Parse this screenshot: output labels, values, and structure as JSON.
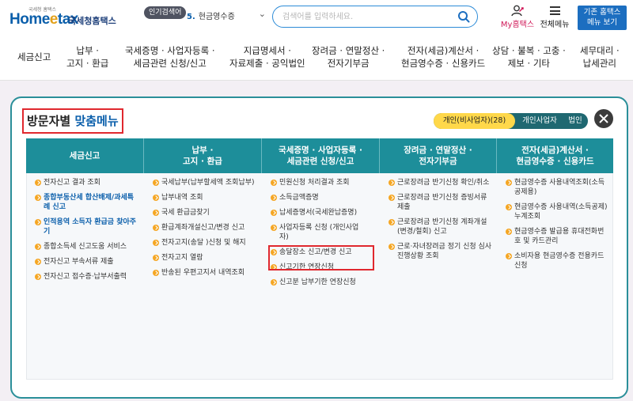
{
  "header": {
    "logo_small": "국세청 홈택스",
    "logo_home": "Home",
    "logo_e": "e",
    "logo_tax": "tax",
    "logo_sub": "국세청홈택스",
    "popular_label": "인기검색어",
    "popular_num": "5.",
    "popular_value": "현금영수증",
    "search_placeholder": "검색어를 입력하세요.",
    "my_hometax": "My홈택스",
    "all_menu": "전체메뉴",
    "old_home_line1": "기존 홈택스",
    "old_home_line2": "메뉴 보기"
  },
  "gnb": [
    {
      "line1": "세금신고",
      "line2": ""
    },
    {
      "line1": "납부 ·",
      "line2": "고지 · 환급"
    },
    {
      "line1": "국세증명 · 사업자등록 ·",
      "line2": "세금관련 신청/신고"
    },
    {
      "line1": "지급명세서 ·",
      "line2": "자료제출 · 공익법인"
    },
    {
      "line1": "장려금 · 연말정산 ·",
      "line2": "전자기부금"
    },
    {
      "line1": "전자(세금)계산서 ·",
      "line2": "현금영수증 · 신용카드"
    },
    {
      "line1": "상담 · 불복 · 고충 ·",
      "line2": "제보 · 기타"
    },
    {
      "line1": "세무대리 ·",
      "line2": "납세관리"
    }
  ],
  "modal": {
    "title_prefix": "방문자별",
    "title_accent": "맞춤메뉴",
    "tabs": [
      "개인(비사업자)(28)",
      "개인사업자",
      "법인"
    ],
    "active_tab": 0,
    "columns": [
      {
        "head1": "세금신고",
        "head2": "",
        "items": [
          {
            "text": "전자신고 결과 조회",
            "bold": false
          },
          {
            "text": "종합부동산세 합산배제/과세특례 신고",
            "bold": true
          },
          {
            "text": "인적용역 소득자 환급금 찾아주기",
            "bold": true
          },
          {
            "text": "종합소득세 신고도움 서비스",
            "bold": false
          },
          {
            "text": "전자신고 부속서류 제출",
            "bold": false
          },
          {
            "text": "전자신고 접수증·납부서출력",
            "bold": false
          }
        ]
      },
      {
        "head1": "납부 ·",
        "head2": "고지 · 환급",
        "items": [
          {
            "text": "국세납부(납부할세액 조회납부)",
            "bold": false
          },
          {
            "text": "납부내역 조회",
            "bold": false
          },
          {
            "text": "국세 환급금찾기",
            "bold": false
          },
          {
            "text": "환급계좌개설신고/변경 신고",
            "bold": false
          },
          {
            "text": "전자고지(송달 )신청 및 해지",
            "bold": false
          },
          {
            "text": "전자고지 열람",
            "bold": false
          },
          {
            "text": "반송된 우편고지서 내역조회",
            "bold": false
          }
        ]
      },
      {
        "head1": "국세증명 · 사업자등록 ·",
        "head2": "세금관련 신청/신고",
        "items": [
          {
            "text": "민원신청 처리결과 조회",
            "bold": false
          },
          {
            "text": "소득금액증명",
            "bold": false
          },
          {
            "text": "납세증명서(국세완납증명)",
            "bold": false
          },
          {
            "text": "사업자등록 신청 (개인사업자)",
            "bold": false
          },
          {
            "text": "송달장소 신고/변경 신고",
            "bold": false
          },
          {
            "text": "신고기한 연장신청",
            "bold": false
          },
          {
            "text": "신고분 납부기한 연장신청",
            "bold": false
          }
        ]
      },
      {
        "head1": "장려금 · 연말정산 ·",
        "head2": "전자기부금",
        "items": [
          {
            "text": "근로장려금 반기신청 확인/취소",
            "bold": false
          },
          {
            "text": "근로장려금 반기신청 증빙서류 제출",
            "bold": false
          },
          {
            "text": "근로장려금 반기신청 계좌개설(변경/철회) 신고",
            "bold": false
          },
          {
            "text": "근로·자녀장려금 정기 신청 심사 진행상황 조회",
            "bold": false
          }
        ]
      },
      {
        "head1": "전자(세금)계산서 ·",
        "head2": "현금영수증 · 신용카드",
        "items": [
          {
            "text": "현금영수증 사용내역조회(소득공제용)",
            "bold": false
          },
          {
            "text": "현금영수증 사용내역(소득공제)누계조회",
            "bold": false
          },
          {
            "text": "현금영수증 발급용 휴대전화번호 및 카드관리",
            "bold": false
          },
          {
            "text": "소비자용 현금영수증 전용카드 신청",
            "bold": false
          }
        ]
      }
    ]
  }
}
